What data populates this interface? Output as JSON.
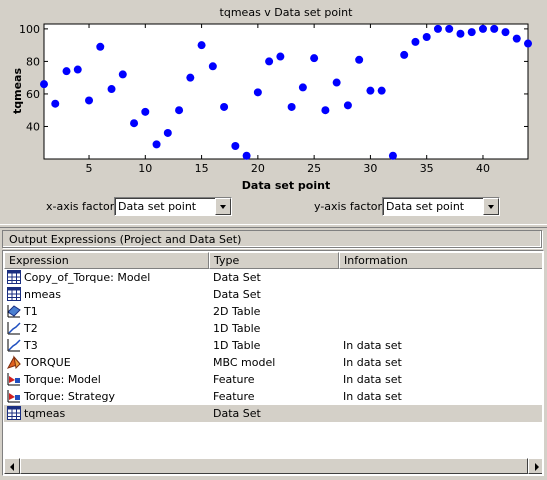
{
  "chart_data": {
    "type": "scatter",
    "title": "tqmeas v Data set point",
    "xlabel": "Data set point",
    "ylabel": "tqmeas",
    "xlim": [
      1,
      44
    ],
    "ylim": [
      20,
      103
    ],
    "xticks": [
      5,
      10,
      15,
      20,
      25,
      30,
      35,
      40
    ],
    "yticks": [
      40,
      60,
      80,
      100
    ],
    "marker_color": "#0000ff",
    "grid": false,
    "points": [
      [
        1,
        66
      ],
      [
        2,
        54
      ],
      [
        3,
        74
      ],
      [
        4,
        75
      ],
      [
        5,
        56
      ],
      [
        6,
        89
      ],
      [
        7,
        63
      ],
      [
        8,
        72
      ],
      [
        9,
        42
      ],
      [
        10,
        49
      ],
      [
        11,
        29
      ],
      [
        12,
        36
      ],
      [
        13,
        50
      ],
      [
        14,
        70
      ],
      [
        15,
        90
      ],
      [
        16,
        77
      ],
      [
        17,
        52
      ],
      [
        18,
        28
      ],
      [
        19,
        22
      ],
      [
        20,
        61
      ],
      [
        21,
        80
      ],
      [
        22,
        83
      ],
      [
        23,
        52
      ],
      [
        24,
        64
      ],
      [
        25,
        82
      ],
      [
        26,
        50
      ],
      [
        27,
        67
      ],
      [
        28,
        53
      ],
      [
        29,
        81
      ],
      [
        30,
        62
      ],
      [
        31,
        62
      ],
      [
        32,
        22
      ],
      [
        33,
        84
      ],
      [
        34,
        92
      ],
      [
        35,
        95
      ],
      [
        36,
        100
      ],
      [
        37,
        100
      ],
      [
        38,
        97
      ],
      [
        39,
        98
      ],
      [
        40,
        100
      ],
      [
        41,
        100
      ],
      [
        42,
        98
      ],
      [
        43,
        94
      ],
      [
        44,
        91
      ]
    ]
  },
  "controls": {
    "x_label": "x-axis factor:",
    "x_value": "Data set point",
    "y_label": "y-axis factor:",
    "y_value": "Data set point"
  },
  "section": {
    "title": "Output Expressions (Project and Data Set)"
  },
  "table": {
    "headers": [
      "Expression",
      "Type",
      "Information"
    ],
    "rows": [
      {
        "icon": "dataset-table-icon",
        "expression": "Copy_of_Torque: Model",
        "type": "Data Set",
        "info": ""
      },
      {
        "icon": "dataset-table-icon",
        "expression": "nmeas",
        "type": "Data Set",
        "info": ""
      },
      {
        "icon": "2d-table-icon",
        "expression": "T1",
        "type": "2D Table",
        "info": ""
      },
      {
        "icon": "1d-table-icon",
        "expression": "T2",
        "type": "1D Table",
        "info": ""
      },
      {
        "icon": "1d-table-icon",
        "expression": "T3",
        "type": "1D Table",
        "info": "In data set"
      },
      {
        "icon": "mbc-model-icon",
        "expression": "TORQUE",
        "type": "MBC model",
        "info": "In data set"
      },
      {
        "icon": "feature-icon",
        "expression": "Torque: Model",
        "type": "Feature",
        "info": "In data set"
      },
      {
        "icon": "feature-icon",
        "expression": "Torque: Strategy",
        "type": "Feature",
        "info": "In data set"
      },
      {
        "icon": "dataset-table-icon",
        "expression": "tqmeas",
        "type": "Data Set",
        "info": "",
        "selected": true
      }
    ]
  }
}
